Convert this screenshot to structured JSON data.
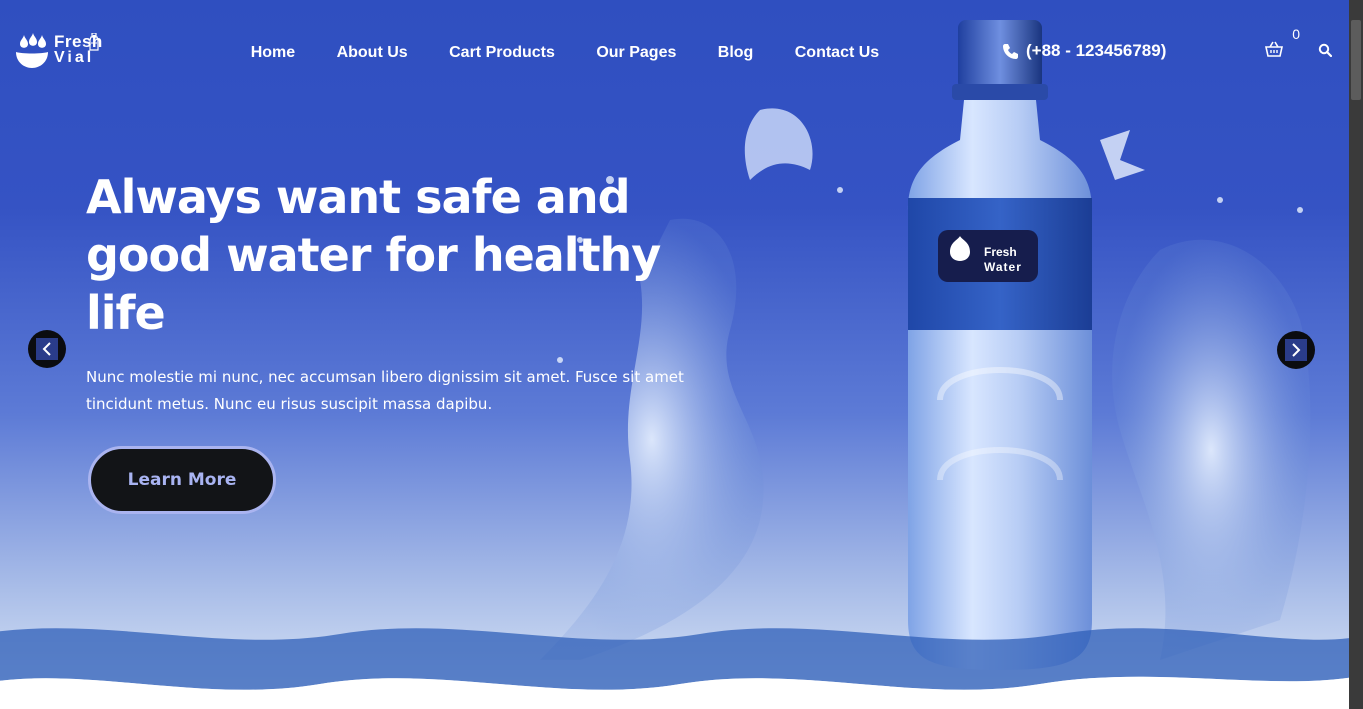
{
  "brand": {
    "name_line1": "Fresh",
    "name_line2": "Vial",
    "label_line1": "Fresh",
    "label_line2": "Water"
  },
  "nav": {
    "items": [
      {
        "label": "Home"
      },
      {
        "label": "About Us"
      },
      {
        "label": "Cart Products"
      },
      {
        "label": "Our Pages"
      },
      {
        "label": "Blog"
      },
      {
        "label": "Contact Us"
      }
    ]
  },
  "contact": {
    "phone": "(+88 - 123456789)",
    "icon": "phone-icon"
  },
  "cart": {
    "count": "0",
    "icon": "basket-icon"
  },
  "search": {
    "icon": "search-icon"
  },
  "hero": {
    "title": "Always want safe and good water for healthy life",
    "description": "Nunc molestie mi nunc, nec accumsan libero dignissim sit amet. Fusce sit amet tincidunt metus. Nunc eu risus suscipit massa dapibu.",
    "cta_label": "Learn More",
    "prev_icon": "chevron-left-icon",
    "next_icon": "chevron-right-icon"
  },
  "colors": {
    "hero_blue": "#3553c4",
    "button_dark": "#121417",
    "button_text": "#a9b4f2"
  }
}
